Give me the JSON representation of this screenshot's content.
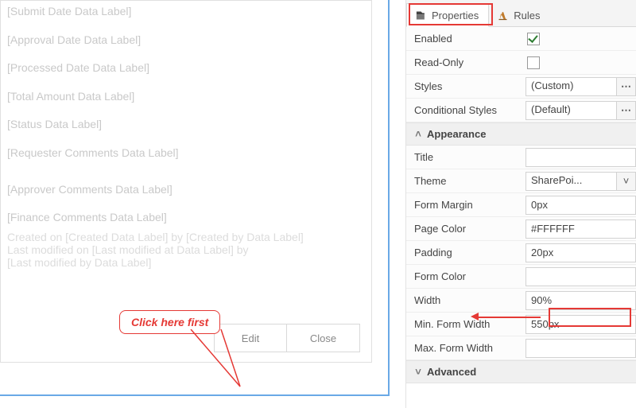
{
  "canvas": {
    "labels": [
      "[Submit Date Data Label]",
      "[Approval Date Data Label]",
      "[Processed Date Data Label]",
      "[Total Amount Data Label]",
      "[Status Data Label]",
      "[Requester Comments Data Label]",
      "[Approver Comments Data Label]",
      "[Finance Comments Data Label]"
    ],
    "meta": {
      "line1_pre": "Created on ",
      "line1_a": "[Created Data Label]",
      "line1_mid": " by ",
      "line1_b": "[Created by Data Label]",
      "line2_pre": "Last modified on ",
      "line2_a": "[Last modified at Data Label]",
      "line2_mid": " by",
      "line3": "[Last modified by Data Label]"
    },
    "buttons": {
      "edit": "Edit",
      "close": "Close"
    }
  },
  "tabs": {
    "properties": "Properties",
    "rules": "Rules"
  },
  "general": {
    "enabled_label": "Enabled",
    "enabled_checked": true,
    "readonly_label": "Read-Only",
    "readonly_checked": false,
    "styles_label": "Styles",
    "styles_value": "(Custom)",
    "cond_styles_label": "Conditional Styles",
    "cond_styles_value": "(Default)"
  },
  "appearance": {
    "header": "Appearance",
    "title_label": "Title",
    "title_value": "",
    "theme_label": "Theme",
    "theme_value": "SharePoi...",
    "form_margin_label": "Form Margin",
    "form_margin_value": "0px",
    "page_color_label": "Page Color",
    "page_color_value": "#FFFFFF",
    "padding_label": "Padding",
    "padding_value": "20px",
    "form_color_label": "Form Color",
    "form_color_value": "",
    "width_label": "Width",
    "width_value": "90%",
    "min_width_label": "Min. Form Width",
    "min_width_value": "550px",
    "max_width_label": "Max. Form Width",
    "max_width_value": ""
  },
  "advanced": {
    "header": "Advanced"
  },
  "annotation": {
    "bubble": "Click here first"
  },
  "colors": {
    "highlight": "#e53935",
    "selection": "#6aa9e6"
  }
}
